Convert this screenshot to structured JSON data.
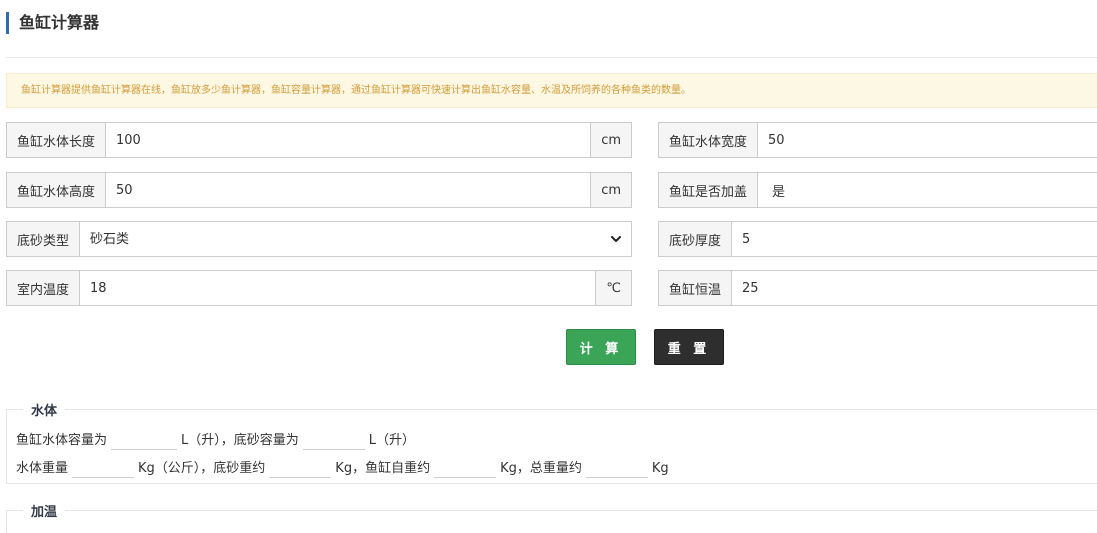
{
  "header": {
    "title": "鱼缸计算器"
  },
  "notice": {
    "text": "鱼缸计算器提供鱼缸计算器在线，鱼缸放多少鱼计算器，鱼缸容量计算器，通过鱼缸计算器可快速计算出鱼缸水容量、水温及所饲养的各种鱼类的数量。"
  },
  "form": {
    "length": {
      "label": "鱼缸水体长度",
      "value": "100",
      "unit": "cm"
    },
    "width": {
      "label": "鱼缸水体宽度",
      "value": "50"
    },
    "height": {
      "label": "鱼缸水体高度",
      "value": "50",
      "unit": "cm"
    },
    "lid": {
      "label": "鱼缸是否加盖",
      "value": "是"
    },
    "sand_type": {
      "label": "底砂类型",
      "selected": "砂石类"
    },
    "sand_thickness": {
      "label": "底砂厚度",
      "value": "5"
    },
    "room_temp": {
      "label": "室内温度",
      "value": "18",
      "unit": "℃"
    },
    "tank_temp": {
      "label": "鱼缸恒温",
      "value": "25"
    }
  },
  "buttons": {
    "calculate": "计 算",
    "reset": "重 置"
  },
  "results": {
    "water": {
      "legend": "水体",
      "line1": {
        "a": "鱼缸水体容量为",
        "b": "L（升），底砂容量为",
        "c": "L（升）"
      },
      "line2": {
        "a": "水体重量",
        "b": "Kg（公斤），底砂重约",
        "c": "Kg，鱼缸自重约",
        "d": "Kg，总重量约",
        "e": "Kg"
      }
    },
    "heating": {
      "legend": "加温"
    }
  }
}
